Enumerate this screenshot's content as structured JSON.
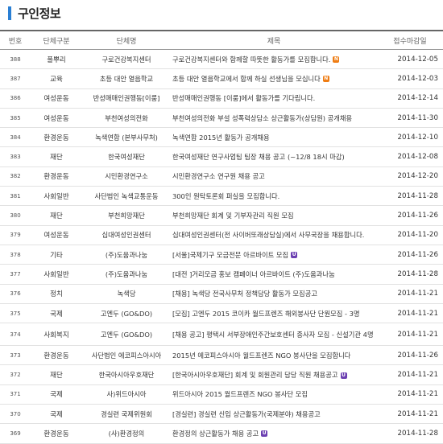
{
  "page_title": "구인정보",
  "headers": {
    "no": "번호",
    "type": "단체구분",
    "org": "단체명",
    "title": "제목",
    "date": "접수마감일"
  },
  "badge_letters": {
    "new": "N",
    "updated": "U"
  },
  "rows": [
    {
      "no": "388",
      "type": "풀뿌리",
      "org": "구로건강복지센터",
      "title": "구로건강복지센터와 함께할 따뜻한 활동가를 모집합니다.",
      "badge": "new",
      "date": "2014-12-05"
    },
    {
      "no": "387",
      "type": "교육",
      "org": "초등 대안 열음학교",
      "title": "초등 대안 열음학교에서 함께 하실 선생님을 모십니다",
      "badge": "new",
      "date": "2014-12-03"
    },
    {
      "no": "386",
      "type": "여성운동",
      "org": "반성매매인권행동[이룸]",
      "title": "반성매매인권행동 [이룸]에서 활동가를 기다립니다.",
      "badge": "",
      "date": "2014-12-14"
    },
    {
      "no": "385",
      "type": "여성운동",
      "org": "부천여성의전화",
      "title": "부천여성의전화 부설 성폭력상담소 상근활동가(상담원) 공개채용",
      "badge": "",
      "date": "2014-11-30"
    },
    {
      "no": "384",
      "type": "환경운동",
      "org": "녹색연합 (본부사무처)",
      "title": "녹색연합 2015년 활동가 공개채용",
      "badge": "",
      "date": "2014-12-10"
    },
    {
      "no": "383",
      "type": "재단",
      "org": "한국여성재단",
      "title": "한국여성재단 연구사업팀 팀장 채용 공고 (~12/8 18시 마감)",
      "badge": "",
      "date": "2014-12-08"
    },
    {
      "no": "382",
      "type": "환경운동",
      "org": "시민환경연구소",
      "title": "시민환경연구소 연구원 채용 공고",
      "badge": "",
      "date": "2014-12-20"
    },
    {
      "no": "381",
      "type": "사회일반",
      "org": "사단법인 녹색교통운동",
      "title": "300인 원탁토론회 퍼실을 모집합니다.",
      "badge": "",
      "date": "2014-11-28"
    },
    {
      "no": "380",
      "type": "재단",
      "org": "부천희망재단",
      "title": "부천희망재단 회계 및 기부자관리 직원 모집",
      "badge": "",
      "date": "2014-11-26"
    },
    {
      "no": "379",
      "type": "여성운동",
      "org": "십대여성인권센터",
      "title": "십대여성인권센터(전 사이버또래상담실)에서 사무국장을 채용합니다.",
      "badge": "",
      "date": "2014-11-20"
    },
    {
      "no": "378",
      "type": "기타",
      "org": "(주)도움과나눔",
      "title": "[서울]국제기구 모금전문 아르바이트 모집",
      "badge": "updated",
      "date": "2014-11-26"
    },
    {
      "no": "377",
      "type": "사회일반",
      "org": "(주)도움과나눔",
      "title": "[대전 ]거리모금 홍보 캠페이너 아르바이트 (주)도움과나눔",
      "badge": "",
      "date": "2014-11-28"
    },
    {
      "no": "376",
      "type": "정치",
      "org": "녹색당",
      "title": "[채용] 녹색당 전국사무처 정책담당 활동가 모집공고",
      "badge": "",
      "date": "2014-11-21"
    },
    {
      "no": "375",
      "type": "국제",
      "org": "고엔두 (GO&DO)",
      "title": "[모집] 고엔두 2015 코이카 월드프렌즈 해외봉사단 단원모집 - 3명",
      "badge": "",
      "date": "2014-11-21"
    },
    {
      "no": "374",
      "type": "사회복지",
      "org": "고엔두 (GO&DO)",
      "title": "[채용 공고] 평택시 서부장애인주간보호센터 종사자 모집 - 신설기관 4명",
      "badge": "",
      "date": "2014-11-21",
      "tall": true
    },
    {
      "no": "373",
      "type": "환경운동",
      "org": "사단법인 에코피스아시아",
      "title": "2015년 에코피스아시아 월드프렌즈 NGO 봉사단을 모집합니다",
      "badge": "",
      "date": "2014-11-26"
    },
    {
      "no": "372",
      "type": "재단",
      "org": "한국아시아우호재단",
      "title": "[한국아시아우호재단] 회계 및 회원관리 담당 직원 채용공고",
      "badge": "updated",
      "date": "2014-11-21"
    },
    {
      "no": "371",
      "type": "국제",
      "org": "사)위드아시아",
      "title": "위드아시아 2015 월드프렌즈 NGO 봉사단 모집",
      "badge": "",
      "date": "2014-11-21"
    },
    {
      "no": "370",
      "type": "국제",
      "org": "경실련 국제위원회",
      "title": "[경실련] 경실련 신입 상근활동가(국제분야) 채용공고",
      "badge": "",
      "date": "2014-11-21"
    },
    {
      "no": "369",
      "type": "환경운동",
      "org": "(사)환경정의",
      "title": "환경정의 상근활동가 채용 공고",
      "badge": "updated",
      "date": "2014-11-28"
    }
  ],
  "colors": {
    "accent": "#2a7fd4",
    "new_badge": "#ef7d14",
    "updated_badge": "#6b3fb1"
  }
}
